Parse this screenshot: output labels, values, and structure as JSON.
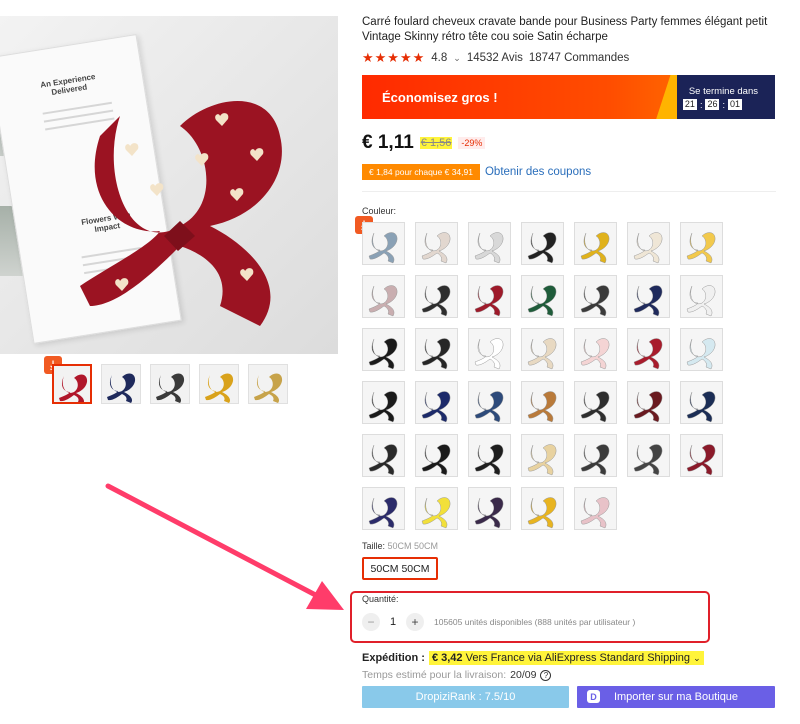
{
  "colors": {
    "accent": "#e62e04",
    "highlight": "#fff43a",
    "promo_dark": "#1b2357",
    "arrow": "#ff3c6a",
    "rank_button": "#89c9ea",
    "import_button": "#6a5fe6"
  },
  "gallery": {
    "main_image_text": {
      "heading": "An Experience Delivered",
      "subheading": "Flowers With Impact"
    },
    "thumbnails": [
      {
        "color": "#b0162a",
        "active": true
      },
      {
        "color": "#1f2a5c"
      },
      {
        "color": "#3a3a3a"
      },
      {
        "color": "#d9a21b"
      },
      {
        "color": "#c7a34a"
      }
    ]
  },
  "product": {
    "title": "Carré foulard cheveux cravate bande pour Business Party femmes élégant petit Vintage Skinny rétro tête cou soie Satin écharpe",
    "rating": "4.8",
    "reviews": "14532 Avis",
    "orders": "18747 Commandes"
  },
  "promo": {
    "label": "Économisez gros !",
    "ends_label": "Se termine dans",
    "timer": [
      "21",
      "26",
      "01"
    ]
  },
  "price": {
    "current": "€ 1,11",
    "old": "€ 1,56",
    "discount": "-29%"
  },
  "coupon": {
    "tag": "€ 1,84 pour chaque € 34,91",
    "link": "Obtenir des coupons"
  },
  "couleur": {
    "label": "Couleur:",
    "swatches": [
      "#8aa1b5",
      "#e2d7cf",
      "#d8d8d8",
      "#222222",
      "#e0b21c",
      "#efe6d6",
      "#f2c94c",
      "#c9aeb0",
      "#2d2d2d",
      "#9e1a2a",
      "#1f5c3a",
      "#3a3a3a",
      "#1f2a5c",
      "#f0f0f0",
      "#1a1a1a",
      "#262626",
      "#ffffff",
      "#e8d9c2",
      "#f4d4d4",
      "#a81c2c",
      "#d5e9f0",
      "#1a1a1a",
      "#1c2a6a",
      "#2d4a7a",
      "#b97a3a",
      "#2e2e2e",
      "#6a1a20",
      "#1b2d55",
      "#2a2a2a",
      "#1a1a1a",
      "#1e1e1e",
      "#e8d2a0",
      "#3b3b3b",
      "#444444",
      "#8b1a2a",
      "#2b2b6a",
      "#f2e03a",
      "#3a2a4a",
      "#e8b420",
      "#e8c2c8"
    ]
  },
  "taille": {
    "label": "Taille:",
    "value": "50CM 50CM",
    "button": "50CM 50CM"
  },
  "quantity": {
    "label": "Quantité:",
    "minus": "−",
    "value": "1",
    "plus": "+",
    "available": "105605 unités disponibles (888 unités par utilisateur )"
  },
  "shipping": {
    "label": "Expédition :",
    "price": "€ 3,42",
    "details": "Vers France via AliExpress Standard Shipping",
    "chevron": "⌄"
  },
  "delivery": {
    "label": "Temps estimé pour la livraison:",
    "value": "20/09",
    "icon": "?"
  },
  "buttons": {
    "rank": "DropiziRank : 7.5/10",
    "import": "Importer sur ma Boutique",
    "import_icon": "D"
  },
  "icons": {
    "download": "download-icon",
    "star": "star-icon",
    "question": "question-icon"
  }
}
